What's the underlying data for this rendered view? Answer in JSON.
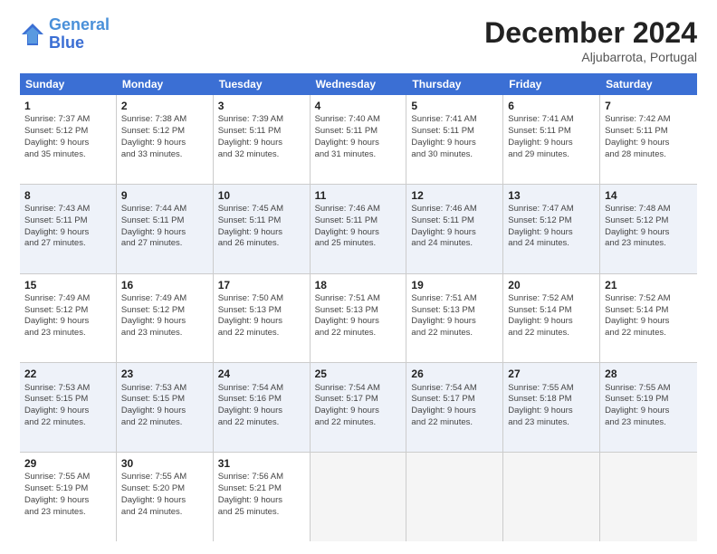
{
  "header": {
    "logo_line1": "General",
    "logo_line2": "Blue",
    "month": "December 2024",
    "location": "Aljubarrota, Portugal"
  },
  "weekdays": [
    "Sunday",
    "Monday",
    "Tuesday",
    "Wednesday",
    "Thursday",
    "Friday",
    "Saturday"
  ],
  "rows": [
    {
      "shade": false,
      "cells": [
        {
          "day": "1",
          "lines": [
            "Sunrise: 7:37 AM",
            "Sunset: 5:12 PM",
            "Daylight: 9 hours",
            "and 35 minutes."
          ]
        },
        {
          "day": "2",
          "lines": [
            "Sunrise: 7:38 AM",
            "Sunset: 5:12 PM",
            "Daylight: 9 hours",
            "and 33 minutes."
          ]
        },
        {
          "day": "3",
          "lines": [
            "Sunrise: 7:39 AM",
            "Sunset: 5:11 PM",
            "Daylight: 9 hours",
            "and 32 minutes."
          ]
        },
        {
          "day": "4",
          "lines": [
            "Sunrise: 7:40 AM",
            "Sunset: 5:11 PM",
            "Daylight: 9 hours",
            "and 31 minutes."
          ]
        },
        {
          "day": "5",
          "lines": [
            "Sunrise: 7:41 AM",
            "Sunset: 5:11 PM",
            "Daylight: 9 hours",
            "and 30 minutes."
          ]
        },
        {
          "day": "6",
          "lines": [
            "Sunrise: 7:41 AM",
            "Sunset: 5:11 PM",
            "Daylight: 9 hours",
            "and 29 minutes."
          ]
        },
        {
          "day": "7",
          "lines": [
            "Sunrise: 7:42 AM",
            "Sunset: 5:11 PM",
            "Daylight: 9 hours",
            "and 28 minutes."
          ]
        }
      ]
    },
    {
      "shade": true,
      "cells": [
        {
          "day": "8",
          "lines": [
            "Sunrise: 7:43 AM",
            "Sunset: 5:11 PM",
            "Daylight: 9 hours",
            "and 27 minutes."
          ]
        },
        {
          "day": "9",
          "lines": [
            "Sunrise: 7:44 AM",
            "Sunset: 5:11 PM",
            "Daylight: 9 hours",
            "and 27 minutes."
          ]
        },
        {
          "day": "10",
          "lines": [
            "Sunrise: 7:45 AM",
            "Sunset: 5:11 PM",
            "Daylight: 9 hours",
            "and 26 minutes."
          ]
        },
        {
          "day": "11",
          "lines": [
            "Sunrise: 7:46 AM",
            "Sunset: 5:11 PM",
            "Daylight: 9 hours",
            "and 25 minutes."
          ]
        },
        {
          "day": "12",
          "lines": [
            "Sunrise: 7:46 AM",
            "Sunset: 5:11 PM",
            "Daylight: 9 hours",
            "and 24 minutes."
          ]
        },
        {
          "day": "13",
          "lines": [
            "Sunrise: 7:47 AM",
            "Sunset: 5:12 PM",
            "Daylight: 9 hours",
            "and 24 minutes."
          ]
        },
        {
          "day": "14",
          "lines": [
            "Sunrise: 7:48 AM",
            "Sunset: 5:12 PM",
            "Daylight: 9 hours",
            "and 23 minutes."
          ]
        }
      ]
    },
    {
      "shade": false,
      "cells": [
        {
          "day": "15",
          "lines": [
            "Sunrise: 7:49 AM",
            "Sunset: 5:12 PM",
            "Daylight: 9 hours",
            "and 23 minutes."
          ]
        },
        {
          "day": "16",
          "lines": [
            "Sunrise: 7:49 AM",
            "Sunset: 5:12 PM",
            "Daylight: 9 hours",
            "and 23 minutes."
          ]
        },
        {
          "day": "17",
          "lines": [
            "Sunrise: 7:50 AM",
            "Sunset: 5:13 PM",
            "Daylight: 9 hours",
            "and 22 minutes."
          ]
        },
        {
          "day": "18",
          "lines": [
            "Sunrise: 7:51 AM",
            "Sunset: 5:13 PM",
            "Daylight: 9 hours",
            "and 22 minutes."
          ]
        },
        {
          "day": "19",
          "lines": [
            "Sunrise: 7:51 AM",
            "Sunset: 5:13 PM",
            "Daylight: 9 hours",
            "and 22 minutes."
          ]
        },
        {
          "day": "20",
          "lines": [
            "Sunrise: 7:52 AM",
            "Sunset: 5:14 PM",
            "Daylight: 9 hours",
            "and 22 minutes."
          ]
        },
        {
          "day": "21",
          "lines": [
            "Sunrise: 7:52 AM",
            "Sunset: 5:14 PM",
            "Daylight: 9 hours",
            "and 22 minutes."
          ]
        }
      ]
    },
    {
      "shade": true,
      "cells": [
        {
          "day": "22",
          "lines": [
            "Sunrise: 7:53 AM",
            "Sunset: 5:15 PM",
            "Daylight: 9 hours",
            "and 22 minutes."
          ]
        },
        {
          "day": "23",
          "lines": [
            "Sunrise: 7:53 AM",
            "Sunset: 5:15 PM",
            "Daylight: 9 hours",
            "and 22 minutes."
          ]
        },
        {
          "day": "24",
          "lines": [
            "Sunrise: 7:54 AM",
            "Sunset: 5:16 PM",
            "Daylight: 9 hours",
            "and 22 minutes."
          ]
        },
        {
          "day": "25",
          "lines": [
            "Sunrise: 7:54 AM",
            "Sunset: 5:17 PM",
            "Daylight: 9 hours",
            "and 22 minutes."
          ]
        },
        {
          "day": "26",
          "lines": [
            "Sunrise: 7:54 AM",
            "Sunset: 5:17 PM",
            "Daylight: 9 hours",
            "and 22 minutes."
          ]
        },
        {
          "day": "27",
          "lines": [
            "Sunrise: 7:55 AM",
            "Sunset: 5:18 PM",
            "Daylight: 9 hours",
            "and 23 minutes."
          ]
        },
        {
          "day": "28",
          "lines": [
            "Sunrise: 7:55 AM",
            "Sunset: 5:19 PM",
            "Daylight: 9 hours",
            "and 23 minutes."
          ]
        }
      ]
    },
    {
      "shade": false,
      "cells": [
        {
          "day": "29",
          "lines": [
            "Sunrise: 7:55 AM",
            "Sunset: 5:19 PM",
            "Daylight: 9 hours",
            "and 23 minutes."
          ]
        },
        {
          "day": "30",
          "lines": [
            "Sunrise: 7:55 AM",
            "Sunset: 5:20 PM",
            "Daylight: 9 hours",
            "and 24 minutes."
          ]
        },
        {
          "day": "31",
          "lines": [
            "Sunrise: 7:56 AM",
            "Sunset: 5:21 PM",
            "Daylight: 9 hours",
            "and 25 minutes."
          ]
        },
        {
          "day": "",
          "lines": []
        },
        {
          "day": "",
          "lines": []
        },
        {
          "day": "",
          "lines": []
        },
        {
          "day": "",
          "lines": []
        }
      ]
    }
  ]
}
